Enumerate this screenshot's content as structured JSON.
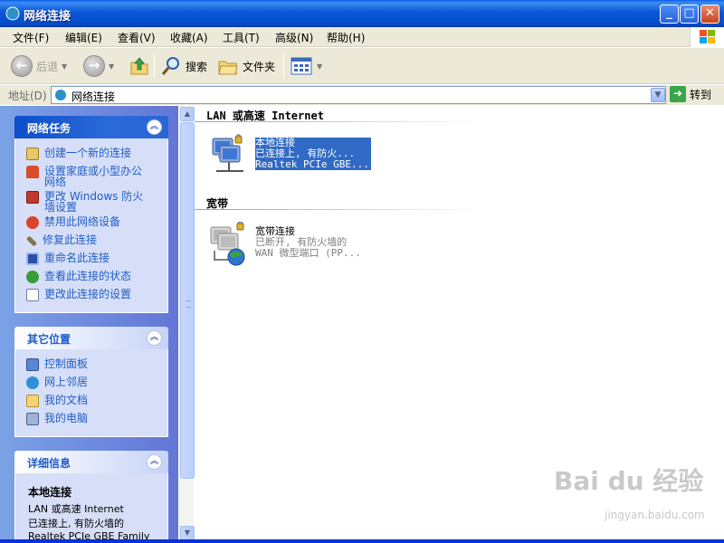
{
  "window": {
    "title": "网络连接"
  },
  "menu": {
    "items": [
      "文件(F)",
      "编辑(E)",
      "查看(V)",
      "收藏(A)",
      "工具(T)",
      "高级(N)",
      "帮助(H)"
    ]
  },
  "toolbar": {
    "back": "后退",
    "search": "搜索",
    "folders": "文件夹"
  },
  "address": {
    "label": "地址(D)",
    "value": "网络连接",
    "go": "转到"
  },
  "tasks": {
    "header": "网络任务",
    "items": [
      "创建一个新的连接",
      "设置家庭或小型办公网络",
      "更改 Windows 防火墙设置",
      "禁用此网络设备",
      "修复此连接",
      "重命名此连接",
      "查看此连接的状态",
      "更改此连接的设置"
    ]
  },
  "places": {
    "header": "其它位置",
    "items": [
      "控制面板",
      "网上邻居",
      "我的文档",
      "我的电脑"
    ]
  },
  "details": {
    "header": "详细信息",
    "name": "本地连接",
    "lines": [
      "LAN 或高速 Internet",
      "已连接上, 有防火墙的",
      "Realtek PCIe GBE Family"
    ]
  },
  "sections": {
    "lan": "LAN 或高速 Internet",
    "broadband": "宽带"
  },
  "connections": {
    "local": {
      "name": "本地连接",
      "status": "已连接上, 有防火...",
      "device": "Realtek PCIe GBE..."
    },
    "broadband": {
      "name": "宽带连接",
      "status": "已断开, 有防火墙的",
      "device": "WAN 微型端口 (PP..."
    }
  },
  "watermark": {
    "text": "Bai du 经验",
    "sub": "jingyan.baidu.com"
  },
  "colors": {
    "titlebar": "#0550cf",
    "taskpane": "#6375d6",
    "link": "#215dc6",
    "selection": "#316ac5"
  }
}
